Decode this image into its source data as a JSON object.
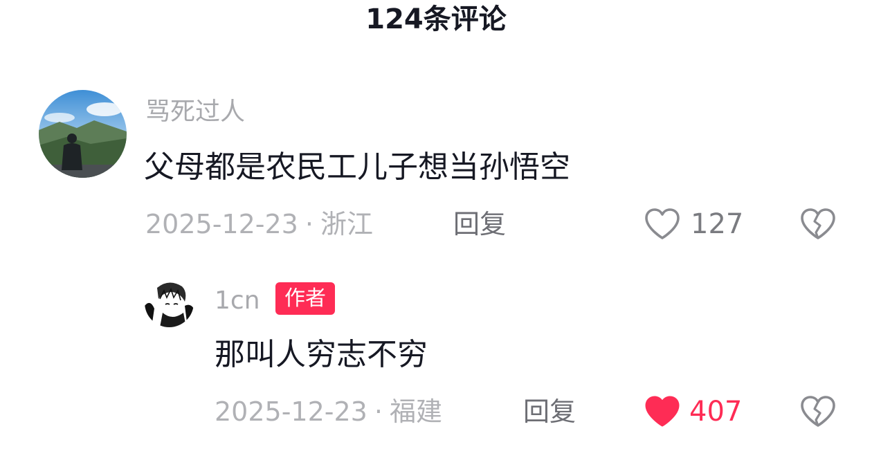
{
  "header": {
    "title": "124条评论"
  },
  "comments": [
    {
      "username": "骂死过人",
      "text": "父母都是农民工儿子想当孙悟空",
      "date": "2025-12-23",
      "separator": "·",
      "location": "浙江",
      "reply_label": "回复",
      "likes": "127",
      "liked": false,
      "avatar_icon": "avatar-landscape-person"
    },
    {
      "username": "1cn",
      "badge": "作者",
      "text": "那叫人穷志不穷",
      "date": "2025-12-23",
      "separator": "·",
      "location": "福建",
      "reply_label": "回复",
      "likes": "407",
      "liked": true,
      "avatar_icon": "avatar-anime-sketch"
    }
  ],
  "colors": {
    "accent": "#fe2c55",
    "text_primary": "#161823",
    "text_secondary": "#a8a9ad"
  }
}
